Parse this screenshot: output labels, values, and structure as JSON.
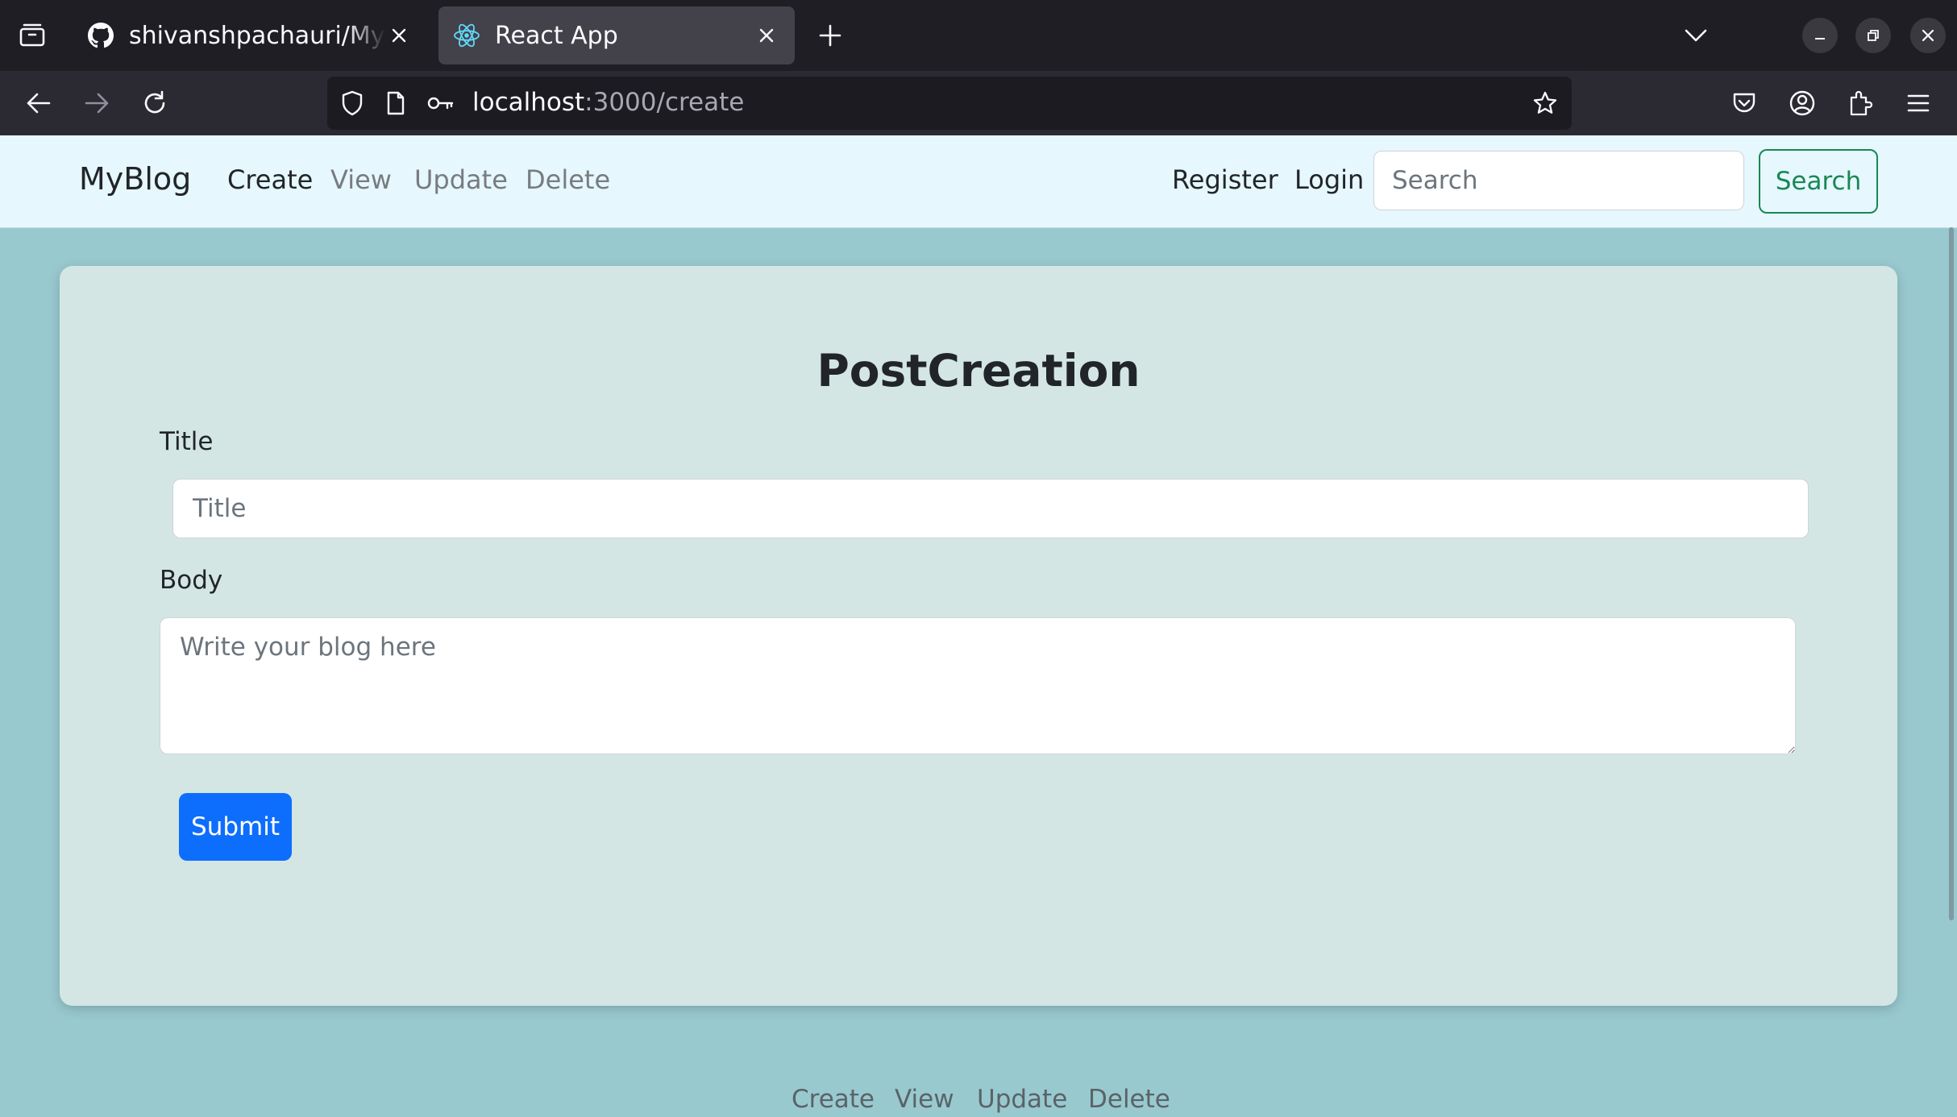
{
  "browser": {
    "tabs": [
      {
        "title": "shivanshpachauri/MyBlog",
        "icon": "github-icon",
        "active": false
      },
      {
        "title": "React App",
        "icon": "react-icon",
        "active": true
      }
    ],
    "url_host": "localhost",
    "url_path": ":3000/create"
  },
  "navbar": {
    "brand": "MyBlog",
    "links": [
      "Create",
      "View",
      "Update",
      "Delete"
    ],
    "active_link": "Create",
    "register": "Register",
    "login": "Login",
    "search_placeholder": "Search",
    "search_button": "Search"
  },
  "form": {
    "heading": "PostCreation",
    "title_label": "Title",
    "title_placeholder": "Title",
    "body_label": "Body",
    "body_placeholder": "Write your blog here",
    "submit": "Submit"
  },
  "footer": {
    "links": [
      "Create",
      "View",
      "Update",
      "Delete"
    ]
  },
  "colors": {
    "page_bg": "#98c9cf",
    "navbar_bg": "#e6f7fd",
    "card_bg": "#d3e6e3",
    "primary": "#0d6efd",
    "success": "#198754"
  }
}
